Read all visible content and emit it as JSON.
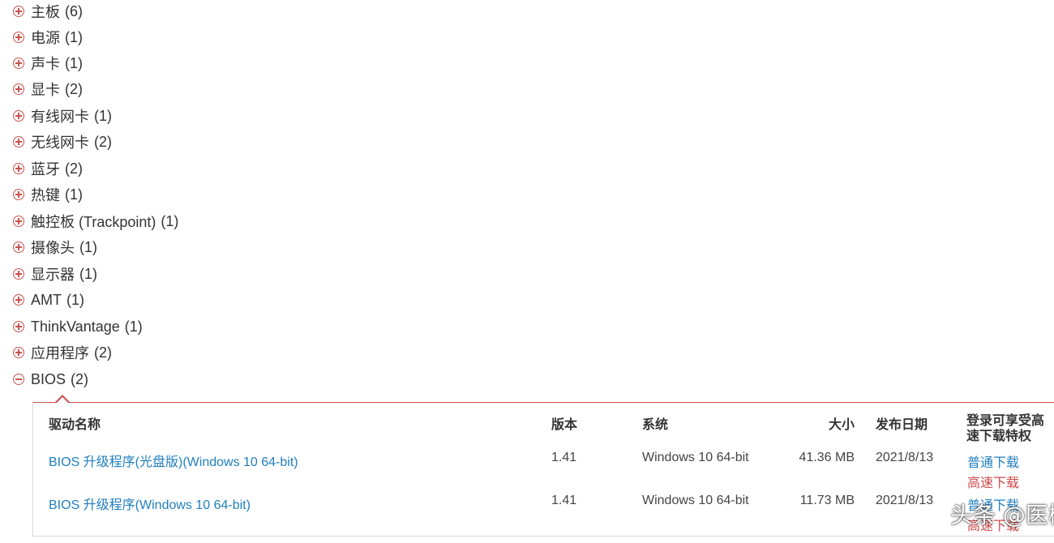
{
  "categories": [
    {
      "label": "主板",
      "count": "(6)",
      "expanded": false
    },
    {
      "label": "电源",
      "count": "(1)",
      "expanded": false
    },
    {
      "label": "声卡",
      "count": "(1)",
      "expanded": false
    },
    {
      "label": "显卡",
      "count": "(2)",
      "expanded": false
    },
    {
      "label": "有线网卡",
      "count": "(1)",
      "expanded": false
    },
    {
      "label": "无线网卡",
      "count": "(2)",
      "expanded": false
    },
    {
      "label": "蓝牙",
      "count": "(2)",
      "expanded": false
    },
    {
      "label": "热键",
      "count": "(1)",
      "expanded": false
    },
    {
      "label": "触控板 (Trackpoint)",
      "count": "(1)",
      "expanded": false
    },
    {
      "label": "摄像头",
      "count": "(1)",
      "expanded": false
    },
    {
      "label": "显示器",
      "count": "(1)",
      "expanded": false
    },
    {
      "label": "AMT",
      "count": "(1)",
      "expanded": false
    },
    {
      "label": "ThinkVantage",
      "count": "(1)",
      "expanded": false
    },
    {
      "label": "应用程序",
      "count": "(2)",
      "expanded": false
    },
    {
      "label": "BIOS",
      "count": "(2)",
      "expanded": true
    }
  ],
  "table": {
    "headers": {
      "name": "驱动名称",
      "version": "版本",
      "system": "系统",
      "size": "大小",
      "date": "发布日期",
      "download": "登录可享受高速下载特权"
    },
    "rows": [
      {
        "name": "BIOS 升级程序(光盘版)(Windows 10 64-bit)",
        "version": "1.41",
        "system": "Windows 10 64-bit",
        "size": "41.36 MB",
        "date": "2021/8/13",
        "normal_download": "普通下载",
        "fast_download": "高速下载"
      },
      {
        "name": "BIOS 升级程序(Windows 10 64-bit)",
        "version": "1.41",
        "system": "Windows 10 64-bit",
        "size": "11.73 MB",
        "date": "2021/8/13",
        "normal_download": "普通下载",
        "fast_download": "高速下载"
      }
    ]
  },
  "watermark": "头条 @医树",
  "colors": {
    "accent": "#c9534f",
    "link": "#1f7fbf",
    "fast_link": "#d04b4b"
  }
}
